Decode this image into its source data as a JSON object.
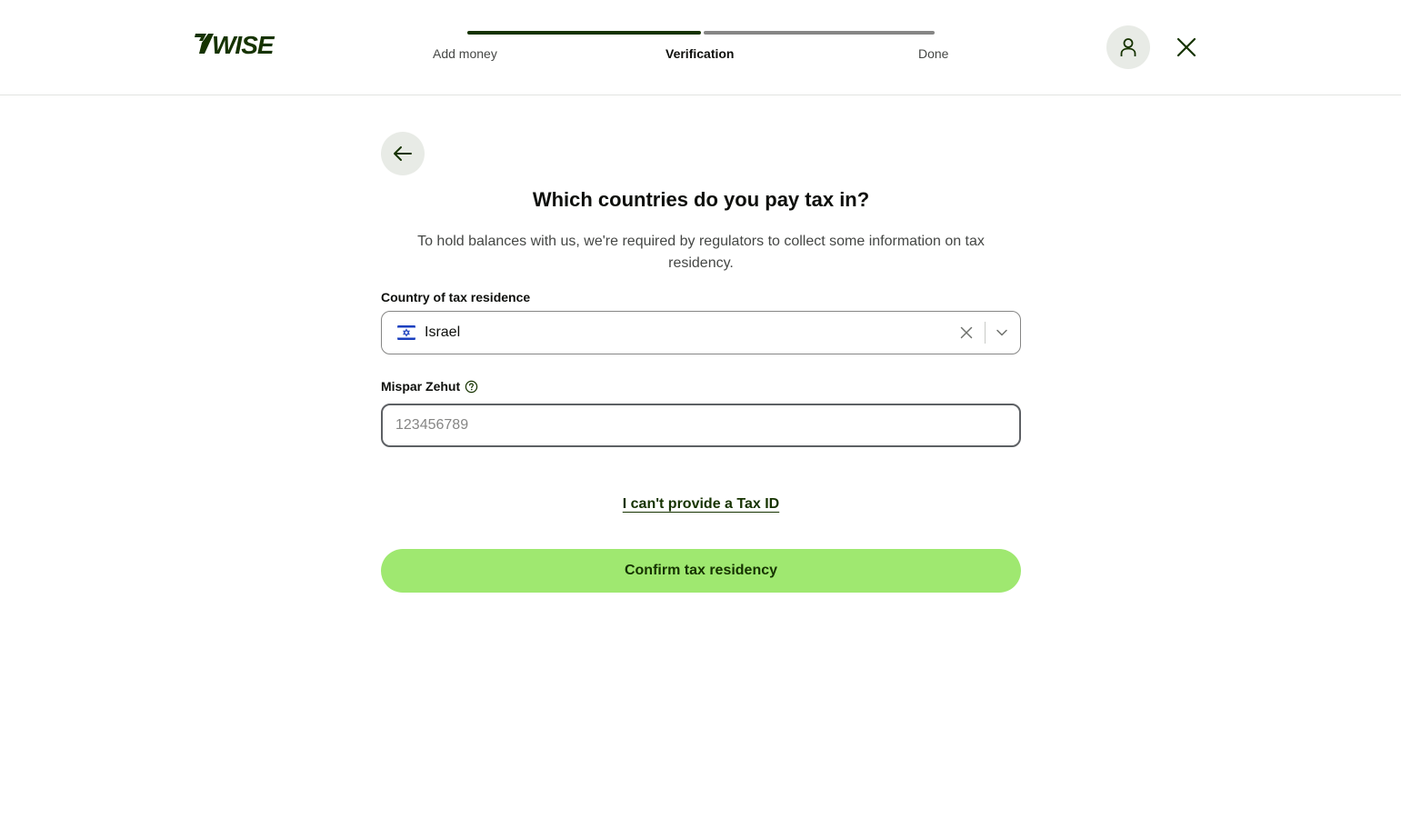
{
  "header": {
    "logo_text": "WISE",
    "steps": [
      {
        "label": "Add money",
        "state": "complete"
      },
      {
        "label": "Verification",
        "state": "current"
      },
      {
        "label": "Done",
        "state": "upcoming"
      }
    ],
    "icons": {
      "avatar": "person-icon",
      "close": "close-icon"
    }
  },
  "main": {
    "back_icon": "arrow-left-icon",
    "title": "Which countries do you pay tax in?",
    "subtitle": "To hold balances with us, we're required by regulators to collect some information on tax residency.",
    "country_field": {
      "label": "Country of tax residence",
      "value": "Israel",
      "flag_icon": "israel-flag-icon"
    },
    "tax_id_field": {
      "label": "Mispar Zehut",
      "value": "",
      "placeholder": "123456789",
      "help_icon": "question-circle-icon"
    },
    "no_tax_id_link": "I can't provide a Tax ID",
    "confirm_button": "Confirm tax residency"
  },
  "colors": {
    "brand_dark": "#163300",
    "brand_green": "#9fe870",
    "neutral_bg": "#e8ebe6"
  }
}
